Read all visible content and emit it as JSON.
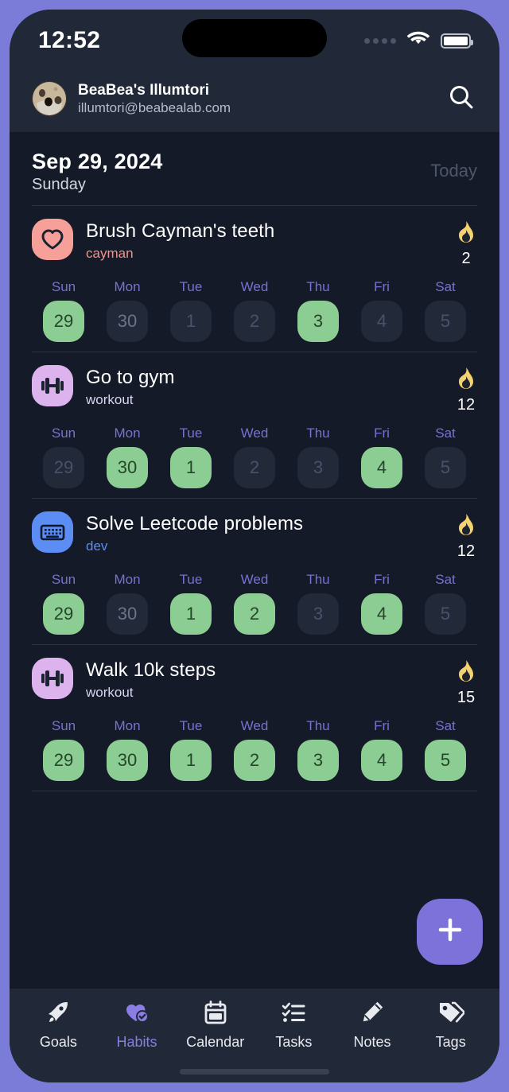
{
  "status_bar": {
    "time": "12:52",
    "signal_icon": "signal-dots-icon",
    "wifi_icon": "wifi-icon",
    "battery_icon": "battery-full-icon"
  },
  "account": {
    "name": "BeaBea's Illumtori",
    "email": "illumtori@beabealab.com",
    "avatar_icon": "user-avatar",
    "search_icon": "search-icon"
  },
  "date_header": {
    "date": "Sep 29, 2024",
    "weekday": "Sunday",
    "today_label": "Today"
  },
  "weekdays": [
    "Sun",
    "Mon",
    "Tue",
    "Wed",
    "Thu",
    "Fri",
    "Sat"
  ],
  "colors": {
    "accent_purple": "#7d72d9",
    "done_green": "#8ccd93",
    "frame_purple": "#7b7bd8",
    "background": "#141a28",
    "panel": "#212838",
    "flame_gold": "#f5d77a"
  },
  "habits": [
    {
      "name": "Brush Cayman's teeth",
      "tag": "cayman",
      "tag_color": "#f2948c",
      "icon": "heart-icon",
      "icon_bg": "#f7a099",
      "icon_fg": "#1b2230",
      "streak_icon": "flame-icon",
      "streak": "2",
      "days": [
        {
          "num": "29",
          "state": "done"
        },
        {
          "num": "30",
          "state": "miss-dim"
        },
        {
          "num": "1",
          "state": "miss"
        },
        {
          "num": "2",
          "state": "miss"
        },
        {
          "num": "3",
          "state": "done"
        },
        {
          "num": "4",
          "state": "miss"
        },
        {
          "num": "5",
          "state": "miss"
        }
      ]
    },
    {
      "name": "Go to gym",
      "tag": "workout",
      "tag_color": "#d9d4f2",
      "icon": "dumbbell-icon",
      "icon_bg": "#ddb3ee",
      "icon_fg": "#1b2230",
      "streak_icon": "flame-icon",
      "streak": "12",
      "days": [
        {
          "num": "29",
          "state": "miss"
        },
        {
          "num": "30",
          "state": "done"
        },
        {
          "num": "1",
          "state": "done"
        },
        {
          "num": "2",
          "state": "miss"
        },
        {
          "num": "3",
          "state": "miss"
        },
        {
          "num": "4",
          "state": "done"
        },
        {
          "num": "5",
          "state": "miss"
        }
      ]
    },
    {
      "name": "Solve Leetcode problems",
      "tag": "dev",
      "tag_color": "#5b8df5",
      "icon": "keyboard-icon",
      "icon_bg": "#5b8df5",
      "icon_fg": "#0e1728",
      "streak_icon": "flame-icon",
      "streak": "12",
      "days": [
        {
          "num": "29",
          "state": "done"
        },
        {
          "num": "30",
          "state": "miss-dim"
        },
        {
          "num": "1",
          "state": "done"
        },
        {
          "num": "2",
          "state": "done"
        },
        {
          "num": "3",
          "state": "miss"
        },
        {
          "num": "4",
          "state": "done"
        },
        {
          "num": "5",
          "state": "miss"
        }
      ]
    },
    {
      "name": "Walk 10k steps",
      "tag": "workout",
      "tag_color": "#d9d4f2",
      "icon": "dumbbell-icon",
      "icon_bg": "#ddb3ee",
      "icon_fg": "#1b2230",
      "streak_icon": "flame-icon",
      "streak": "15",
      "days": [
        {
          "num": "29",
          "state": "done"
        },
        {
          "num": "30",
          "state": "done"
        },
        {
          "num": "1",
          "state": "done"
        },
        {
          "num": "2",
          "state": "done"
        },
        {
          "num": "3",
          "state": "done"
        },
        {
          "num": "4",
          "state": "done"
        },
        {
          "num": "5",
          "state": "done"
        }
      ]
    }
  ],
  "fab": {
    "icon": "plus-icon",
    "label": "+"
  },
  "bottom_nav": {
    "items": [
      {
        "label": "Goals",
        "icon": "rocket-icon",
        "active": false
      },
      {
        "label": "Habits",
        "icon": "heart-check-icon",
        "active": true
      },
      {
        "label": "Calendar",
        "icon": "calendar-icon",
        "active": false
      },
      {
        "label": "Tasks",
        "icon": "checklist-icon",
        "active": false
      },
      {
        "label": "Notes",
        "icon": "pencil-icon",
        "active": false
      },
      {
        "label": "Tags",
        "icon": "tags-icon",
        "active": false
      }
    ]
  }
}
